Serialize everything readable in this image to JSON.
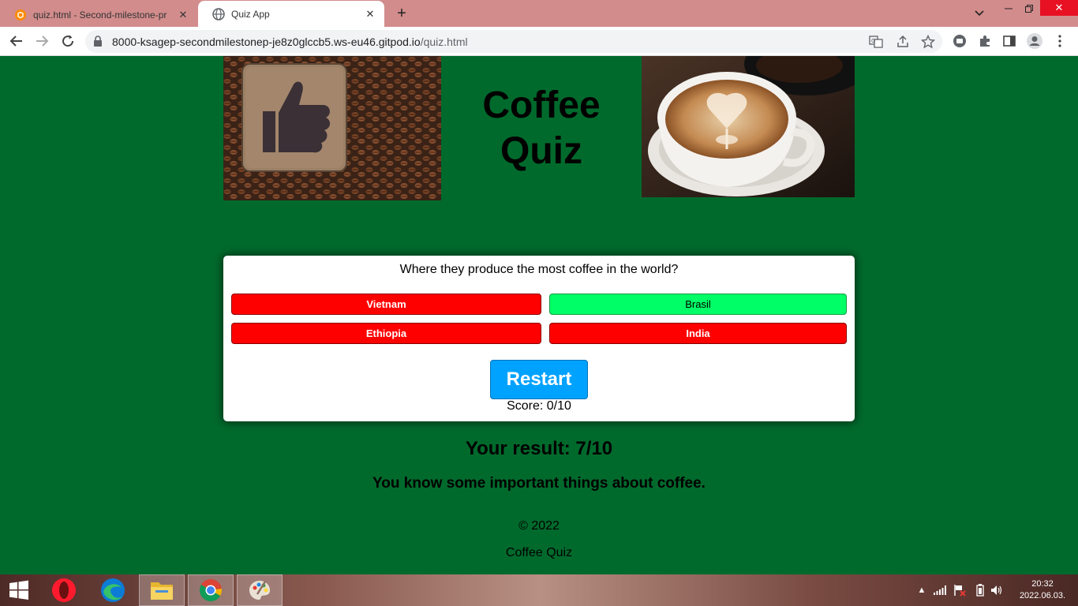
{
  "browser": {
    "tabs": [
      {
        "title": "quiz.html - Second-milestone-pr",
        "favicon": "gitpod-icon",
        "active": false
      },
      {
        "title": "Quiz App",
        "favicon": "globe-icon",
        "active": true
      }
    ],
    "url_host": "8000-ksagep-secondmilestonep-je8z0glccb5.ws-eu46.gitpod.io",
    "url_path": "/quiz.html"
  },
  "header": {
    "title_line1": "Coffee",
    "title_line2": "Quiz"
  },
  "quiz": {
    "question": "Where they produce the most coffee in the world?",
    "answers": [
      {
        "label": "Vietnam",
        "state": "wrong",
        "color": "#ff0000"
      },
      {
        "label": "Brasil",
        "state": "correct",
        "color": "#00ff66"
      },
      {
        "label": "Ethiopia",
        "state": "wrong",
        "color": "#ff0000"
      },
      {
        "label": "India",
        "state": "wrong",
        "color": "#ff0000"
      }
    ],
    "restart_label": "Restart",
    "score_text": "Score: 0/10"
  },
  "result": {
    "heading": "Your result: 7/10",
    "message": "You know some important things about coffee."
  },
  "footer": {
    "copyright": "© 2022",
    "name": "Coffee Quiz"
  },
  "taskbar": {
    "apps": [
      "opera-icon",
      "edge-icon",
      "file-explorer-icon",
      "chrome-icon",
      "paint-icon"
    ],
    "time": "20:32",
    "date": "2022.06.03."
  },
  "colors": {
    "page_background": "#006a2c",
    "wrong_answer": "#ff0000",
    "correct_answer": "#00ff66",
    "restart_button": "#00a2ff"
  }
}
